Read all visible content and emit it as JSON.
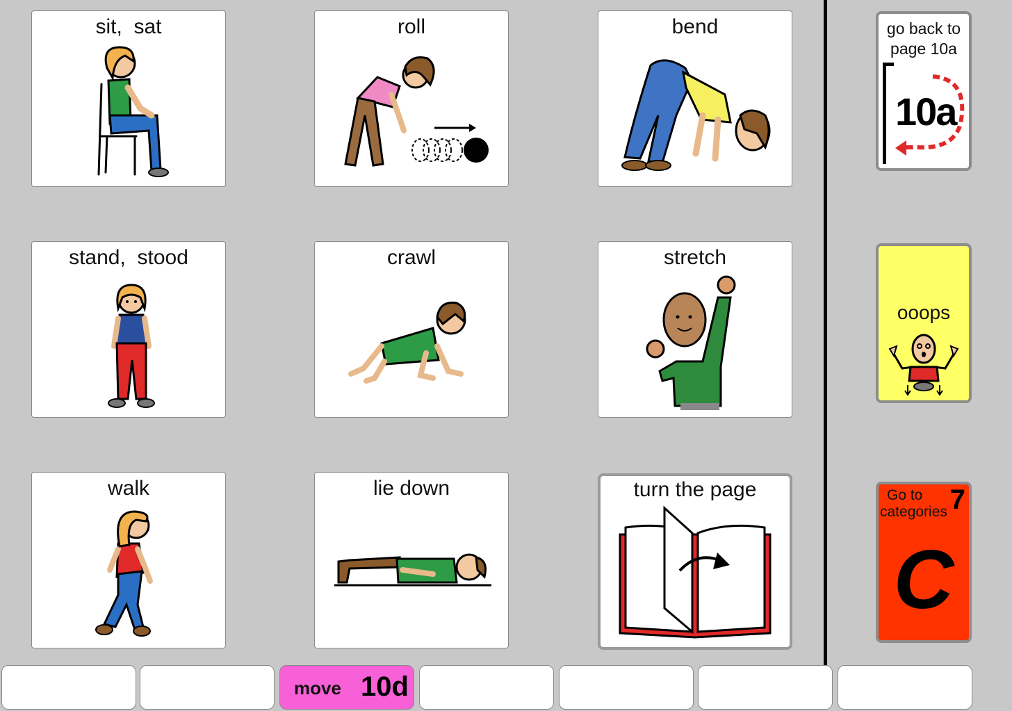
{
  "grid": [
    {
      "label": "sit,  sat",
      "icon": "sitting-person-icon"
    },
    {
      "label": "roll",
      "icon": "rolling-ball-icon"
    },
    {
      "label": "bend",
      "icon": "bending-person-icon"
    },
    {
      "label": "stand,  stood",
      "icon": "standing-person-icon"
    },
    {
      "label": "crawl",
      "icon": "crawling-child-icon"
    },
    {
      "label": "stretch",
      "icon": "stretching-person-icon"
    },
    {
      "label": "walk",
      "icon": "walking-person-icon"
    },
    {
      "label": "lie down",
      "icon": "lying-person-icon"
    },
    {
      "label": "turn the page",
      "icon": "open-book-icon"
    }
  ],
  "side": {
    "back": {
      "line1": "go back to",
      "line2": "page 10a",
      "page": "10a",
      "icon": "return-arrow-icon"
    },
    "oops": {
      "label": "ooops",
      "icon": "dropped-item-person-icon",
      "color": "#ffff66"
    },
    "categories": {
      "line1": "Go to",
      "line2": "categories",
      "number": "7",
      "letter": "C",
      "color": "#ff3300"
    }
  },
  "bottom": {
    "move_label": "move",
    "move_page": "10d",
    "move_color": "#f760d6"
  }
}
